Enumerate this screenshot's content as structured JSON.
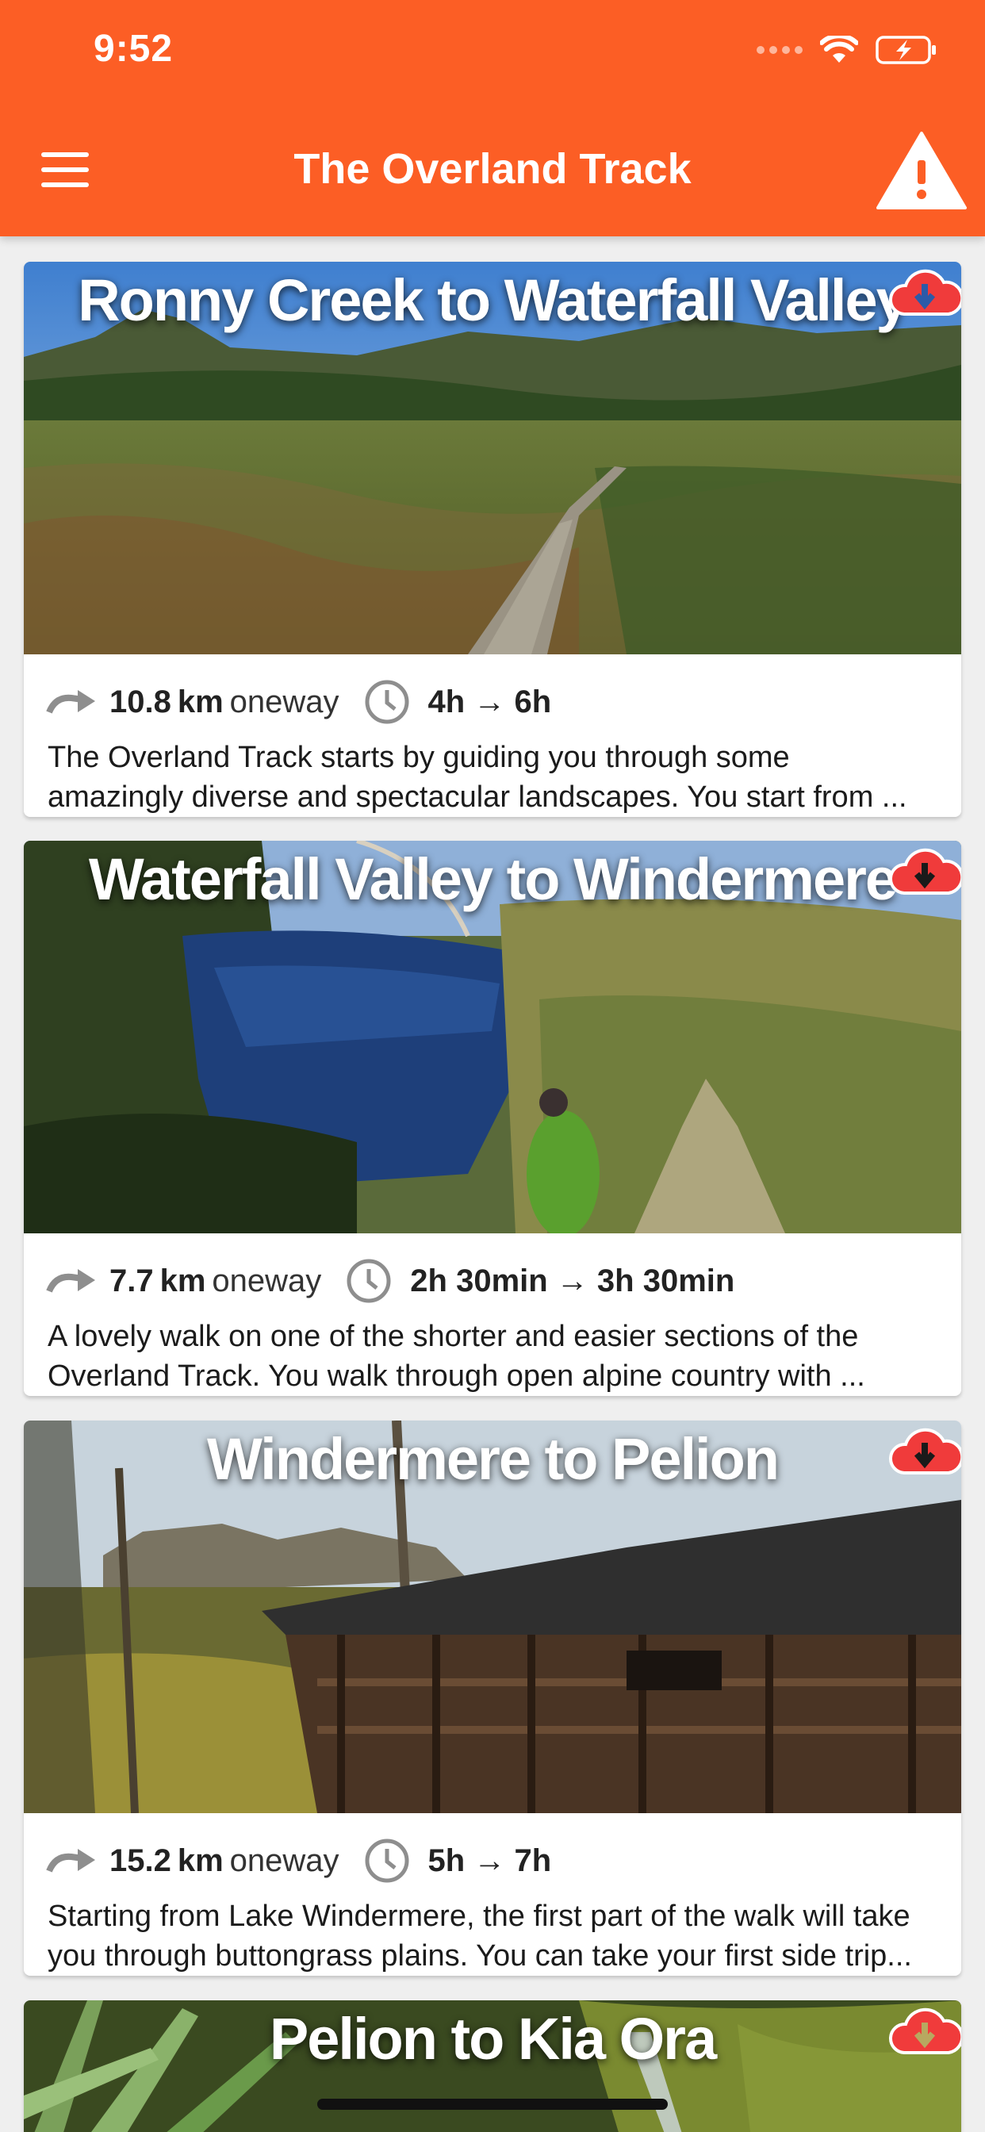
{
  "status_bar": {
    "time": "9:52"
  },
  "header": {
    "title": "The Overland Track",
    "menu_icon": "hamburger-menu-icon",
    "alert_icon": "warning-triangle-icon"
  },
  "colors": {
    "brand_orange": "#fc5e25",
    "download_red": "#f03b3b"
  },
  "sections": [
    {
      "title": "Ronny Creek to Waterfall Valley",
      "distance": "10.8",
      "unit": "km",
      "direction": "oneway",
      "duration": "4h → 6h",
      "desc_line1": "The Overland Track starts by guiding you through some",
      "desc_line2": "amazingly diverse and spectacular landscapes. You start from ..."
    },
    {
      "title": "Waterfall Valley to Windermere",
      "distance": "7.7",
      "unit": "km",
      "direction": "oneway",
      "duration": "2h 30min → 3h 30min",
      "desc_line1": "A lovely walk on one of the shorter and easier sections of the",
      "desc_line2": "Overland Track. You walk through open alpine country with ..."
    },
    {
      "title": "Windermere to Pelion",
      "distance": "15.2",
      "unit": "km",
      "direction": "oneway",
      "duration": "5h → 7h",
      "desc_line1": "Starting from Lake Windermere, the first part of the walk will take",
      "desc_line2": "you through buttongrass plains. You can take your first side trip..."
    },
    {
      "title": "Pelion to Kia Ora"
    }
  ]
}
